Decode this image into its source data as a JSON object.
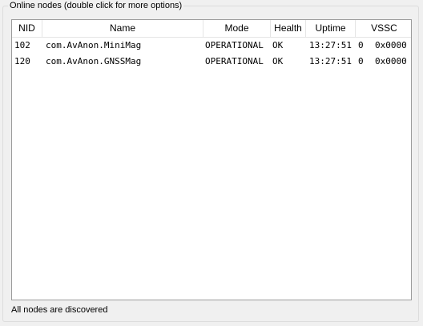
{
  "group": {
    "title": "Online nodes (double click for more options)"
  },
  "table": {
    "columns": [
      "NID",
      "Name",
      "Mode",
      "Health",
      "Uptime",
      "VSSC"
    ],
    "rows": [
      {
        "nid": "102",
        "name": "com.AvAnon.MiniMag",
        "mode": "OPERATIONAL",
        "health": "OK",
        "uptime": "13:27:51",
        "vssc_index": "0",
        "vssc": "0x0000"
      },
      {
        "nid": "120",
        "name": "com.AvAnon.GNSSMag",
        "mode": "OPERATIONAL",
        "health": "OK",
        "uptime": "13:27:51",
        "vssc_index": "0",
        "vssc": "0x0000"
      }
    ]
  },
  "status": {
    "text": "All nodes are discovered"
  }
}
